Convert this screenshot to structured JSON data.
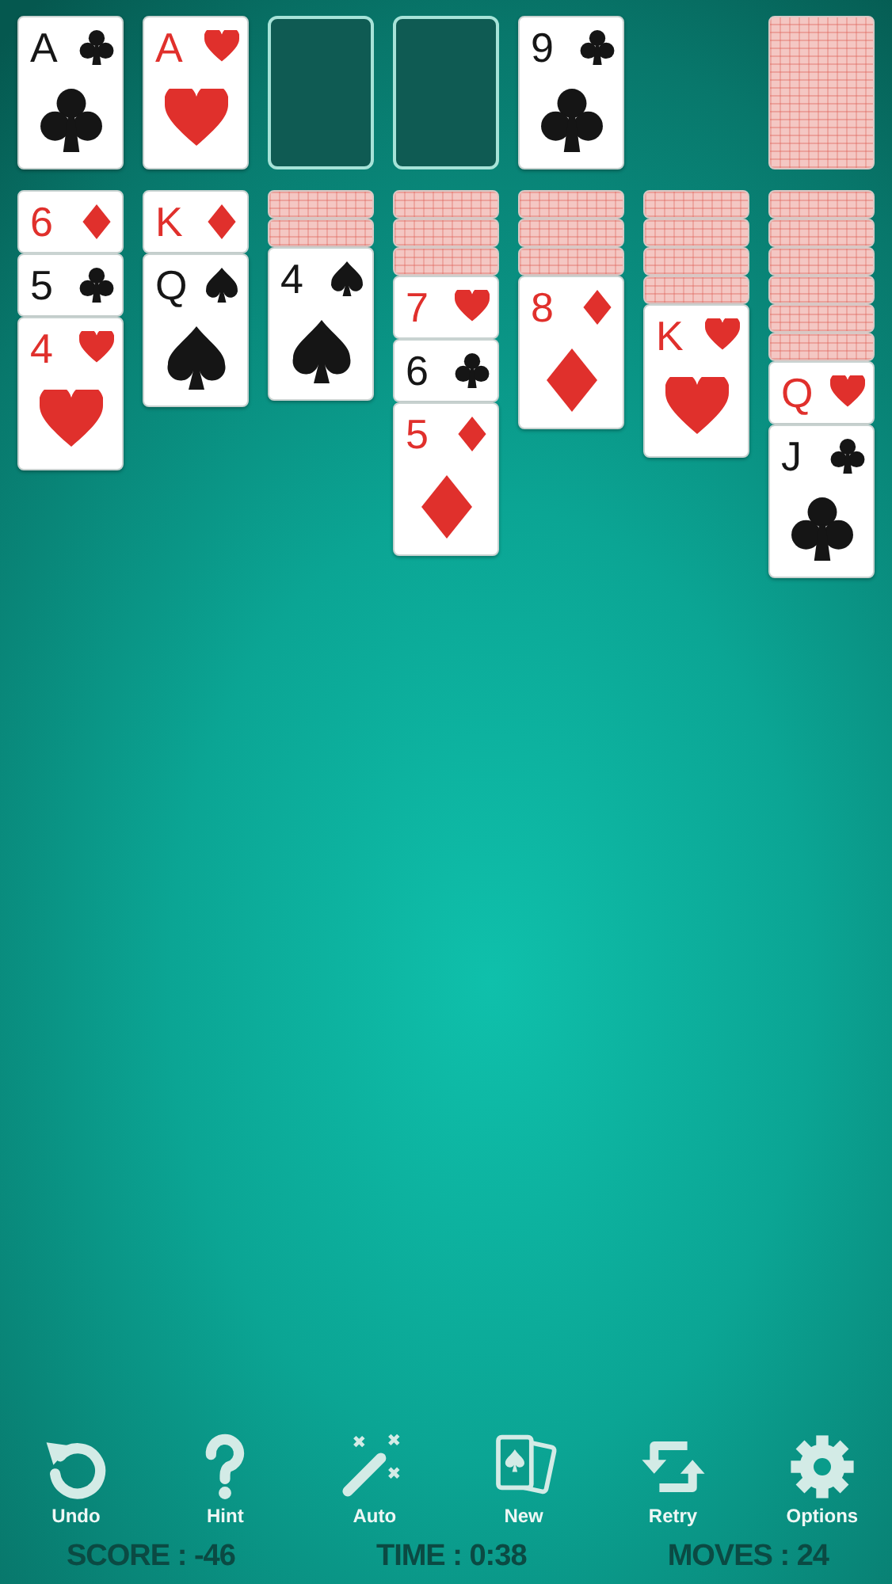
{
  "top_row": [
    {
      "kind": "clubs",
      "rank": "A"
    },
    {
      "kind": "hearts",
      "rank": "A"
    },
    {
      "kind": "empty"
    },
    {
      "kind": "empty"
    },
    {
      "kind": "clubs",
      "rank": "9"
    },
    {
      "kind": "gap"
    },
    {
      "kind": "back"
    }
  ],
  "tableau": [
    {
      "cards": [
        {
          "kind": "diamonds",
          "rank": "6"
        },
        {
          "kind": "clubs",
          "rank": "5"
        },
        {
          "kind": "hearts",
          "rank": "4"
        }
      ]
    },
    {
      "cards": [
        {
          "kind": "diamonds",
          "rank": "K"
        },
        {
          "kind": "spades",
          "rank": "Q"
        }
      ]
    },
    {
      "cards": [
        {
          "kind": "back"
        },
        {
          "kind": "back"
        },
        {
          "kind": "spades",
          "rank": "4"
        }
      ]
    },
    {
      "cards": [
        {
          "kind": "back"
        },
        {
          "kind": "back"
        },
        {
          "kind": "back"
        },
        {
          "kind": "hearts",
          "rank": "7"
        },
        {
          "kind": "clubs",
          "rank": "6"
        },
        {
          "kind": "diamonds",
          "rank": "5"
        }
      ]
    },
    {
      "cards": [
        {
          "kind": "back"
        },
        {
          "kind": "back"
        },
        {
          "kind": "back"
        },
        {
          "kind": "diamonds",
          "rank": "8"
        }
      ]
    },
    {
      "cards": [
        {
          "kind": "back"
        },
        {
          "kind": "back"
        },
        {
          "kind": "back"
        },
        {
          "kind": "back"
        },
        {
          "kind": "hearts",
          "rank": "K"
        }
      ]
    },
    {
      "cards": [
        {
          "kind": "back"
        },
        {
          "kind": "back"
        },
        {
          "kind": "back"
        },
        {
          "kind": "back"
        },
        {
          "kind": "back"
        },
        {
          "kind": "back"
        },
        {
          "kind": "hearts",
          "rank": "Q"
        },
        {
          "kind": "clubs",
          "rank": "J"
        }
      ]
    }
  ],
  "toolbar": [
    {
      "kind": "undo",
      "label": "Undo"
    },
    {
      "kind": "hint",
      "label": "Hint"
    },
    {
      "kind": "auto",
      "label": "Auto"
    },
    {
      "kind": "new",
      "label": "New"
    },
    {
      "kind": "retry",
      "label": "Retry"
    },
    {
      "kind": "options",
      "label": "Options"
    }
  ],
  "status_bar": [
    "SCORE : -46",
    "TIME : 0:38",
    "MOVES : 24"
  ]
}
